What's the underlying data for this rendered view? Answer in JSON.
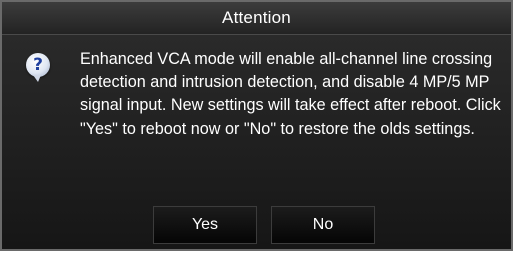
{
  "dialog": {
    "title": "Attention",
    "icon": "question-icon",
    "icon_glyph": "?",
    "message": "Enhanced VCA mode will enable all-channel line crossing detection and intrusion detection, and disable 4 MP/5 MP signal input. New settings will take effect after reboot. Click \"Yes\" to reboot now or \"No\" to restore the olds settings.",
    "buttons": {
      "yes_label": "Yes",
      "no_label": "No"
    }
  },
  "colors": {
    "background": "#000000",
    "title_bar": "#2e2e2e",
    "text": "#ffffff",
    "icon_glyph": "#1f3f9e"
  }
}
